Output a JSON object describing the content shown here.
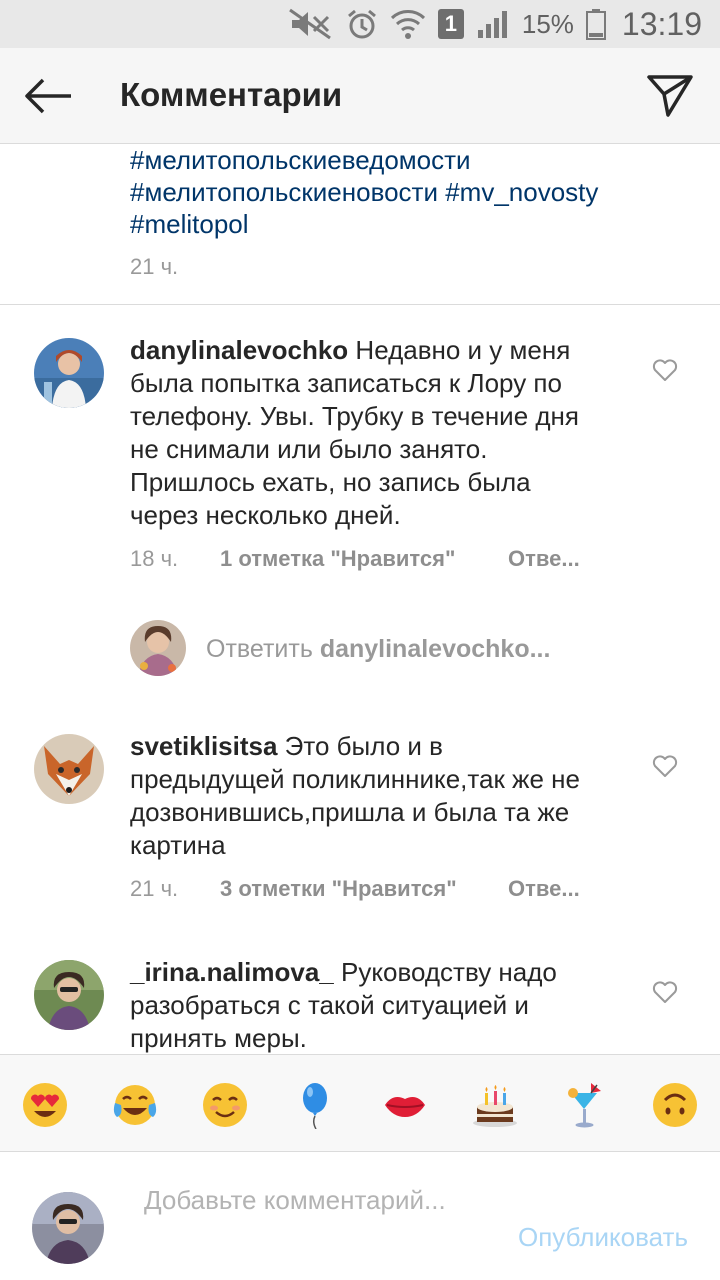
{
  "status_bar": {
    "battery_percent": "15%",
    "time": "13:19",
    "sim_slot": "1"
  },
  "header": {
    "title": "Комментарии"
  },
  "caption": {
    "hashtags_line1": "#мелитопольскиеведомости",
    "hashtags_line2": "#мелитопольскиеновости #mv_novosty",
    "hashtags_line3": "#melitopol",
    "time": "21 ч."
  },
  "comments": [
    {
      "username": "danylinalevochko",
      "text": " Недавно и у меня была попытка записаться к Лору по телефону. Увы. Трубку в течение дня не снимали или было занято. Пришлось ехать, но запись была через несколько дней.",
      "time": "18 ч.",
      "likes": "1 отметка \"Нравится\"",
      "reply": "Отве..."
    },
    {
      "username": "svetiklisitsa",
      "text": " Это было и в предыдущей поликлиннике,так же не дозвонившись,пришла и была та же картина",
      "time": "21 ч.",
      "likes": "3 отметки \"Нравится\"",
      "reply": "Отве..."
    },
    {
      "username": "_irina.nalimova_",
      "text": " Руководству надо разобраться с такой ситуацией и принять меры."
    }
  ],
  "reply_prompt": {
    "prefix": "Ответить ",
    "username": "danylinalevochko..."
  },
  "emoji_bar": {
    "items": [
      "heart-eyes",
      "tears-of-joy",
      "smiling-face",
      "balloon",
      "kiss-lips",
      "birthday-cake",
      "tropical-drink",
      "upside-down-face"
    ]
  },
  "composer": {
    "placeholder": "Добавьте комментарий...",
    "publish_label": "Опубликовать"
  },
  "colors": {
    "accent_link": "#003569",
    "publish_disabled": "#a9d5f5",
    "muted_text": "#999999"
  }
}
